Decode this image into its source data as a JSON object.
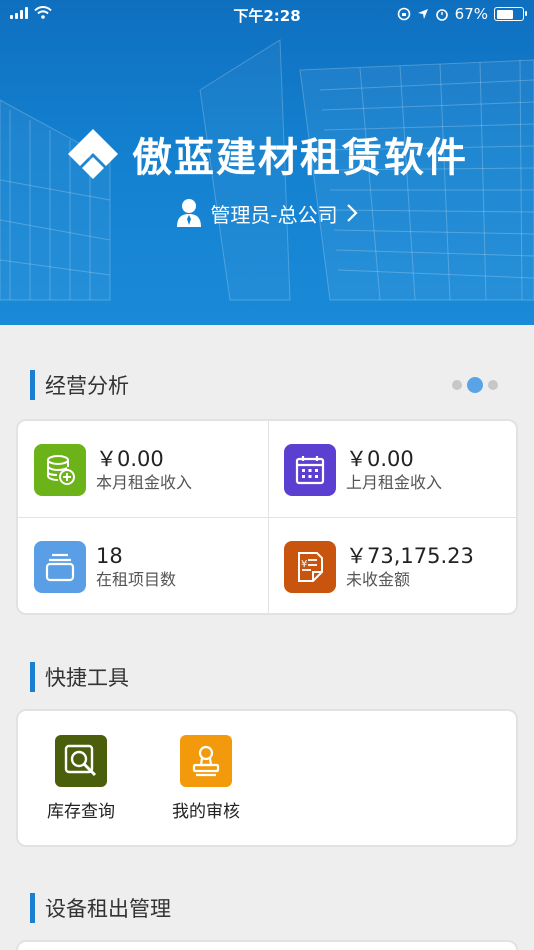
{
  "status_bar": {
    "time": "下午2:28",
    "battery": "67%"
  },
  "header": {
    "app_title": "傲蓝建材租赁软件",
    "user_role": "管理员-总公司"
  },
  "sections": {
    "business_analysis": "经营分析",
    "quick_tools": "快捷工具",
    "equipment_rental": "设备租出管理"
  },
  "stats": [
    {
      "value": "￥0.00",
      "label": "本月租金收入",
      "icon": "database-plus-icon",
      "color": "#6bb319"
    },
    {
      "value": "￥0.00",
      "label": "上月租金收入",
      "icon": "calendar-icon",
      "color": "#5b3fd1"
    },
    {
      "value": "18",
      "label": "在租项目数",
      "icon": "folder-stack-icon",
      "color": "#5a9ee6"
    },
    {
      "value": "￥73,175.23",
      "label": "未收金额",
      "icon": "receipt-icon",
      "color": "#c9540d"
    }
  ],
  "tools": [
    {
      "label": "库存查询",
      "icon": "inventory-search-icon",
      "color": "#4a5e0c"
    },
    {
      "label": "我的审核",
      "icon": "stamp-icon",
      "color": "#f29a0c"
    }
  ],
  "carousel": {
    "pages": 3,
    "active_index": 1
  }
}
